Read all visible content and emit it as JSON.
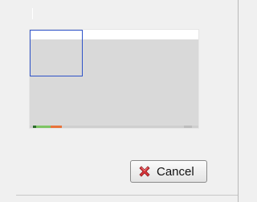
{
  "dialog": {
    "preview": {
      "logo_text": "",
      "sub_text": "",
      "title_text": "",
      "link_text": ""
    },
    "cancel_button": {
      "label": "Cancel",
      "icon": "red-x-icon",
      "icon_color": "#d9343a"
    }
  }
}
